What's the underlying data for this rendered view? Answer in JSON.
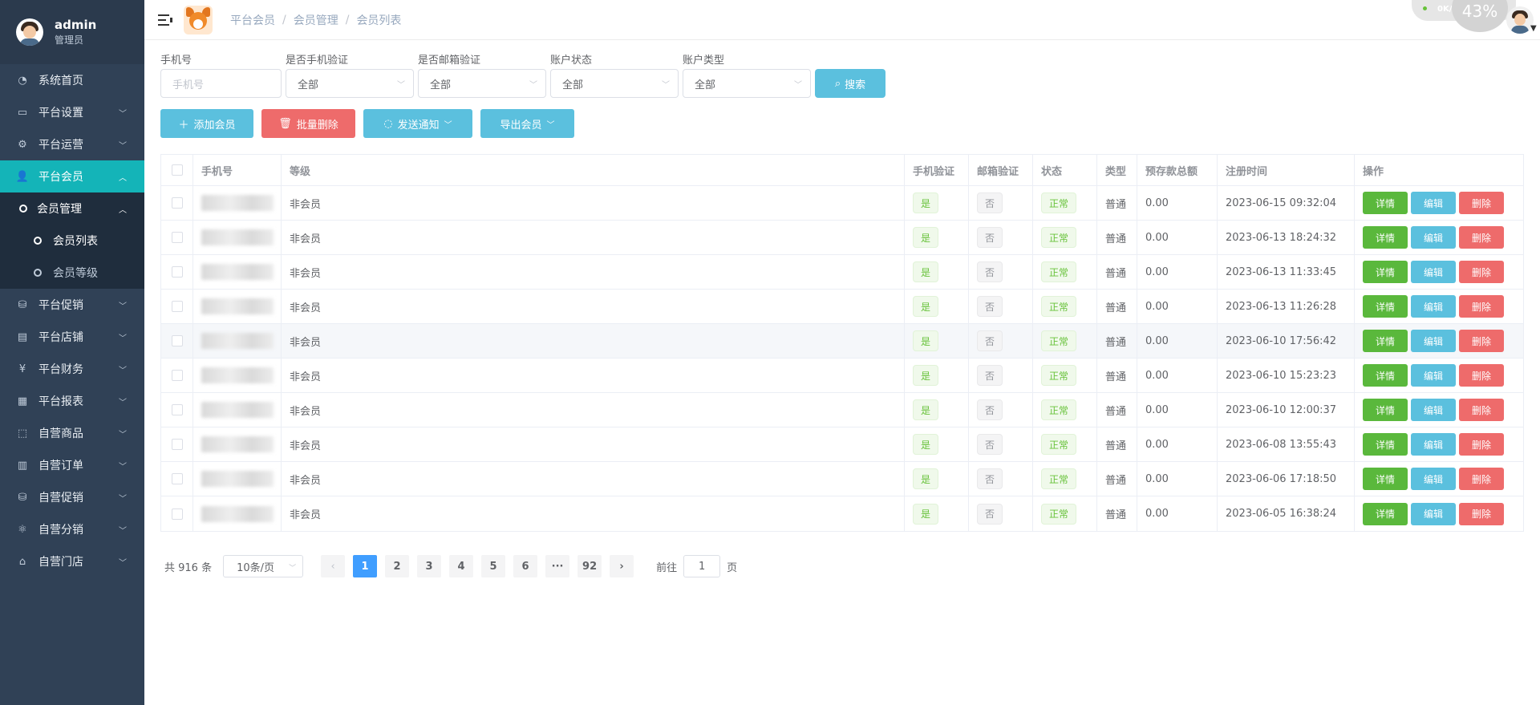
{
  "user": {
    "name": "admin",
    "role": "管理员"
  },
  "sidebar": {
    "items": [
      {
        "label": "系统首页",
        "icon": "dashboard-icon",
        "expandable": false
      },
      {
        "label": "平台设置",
        "icon": "monitor-icon",
        "expandable": true
      },
      {
        "label": "平台运营",
        "icon": "gear-icon",
        "expandable": true
      },
      {
        "label": "平台会员",
        "icon": "member-icon",
        "expandable": true,
        "active": true
      }
    ],
    "sub": {
      "label": "会员管理"
    },
    "subsub": [
      {
        "label": "会员列表",
        "current": true
      },
      {
        "label": "会员等级",
        "current": false
      }
    ],
    "items2": [
      {
        "label": "平台促销",
        "icon": "promo-icon"
      },
      {
        "label": "平台店铺",
        "icon": "shop-icon"
      },
      {
        "label": "平台财务",
        "icon": "yen-icon"
      },
      {
        "label": "平台报表",
        "icon": "report-icon"
      },
      {
        "label": "自营商品",
        "icon": "goods-icon"
      },
      {
        "label": "自营订单",
        "icon": "order-icon"
      },
      {
        "label": "自营促销",
        "icon": "promo-icon"
      },
      {
        "label": "自营分销",
        "icon": "distribution-icon"
      },
      {
        "label": "自营门店",
        "icon": "store-icon"
      }
    ]
  },
  "header": {
    "breadcrumb": [
      "平台会员",
      "会员管理",
      "会员列表"
    ],
    "net_speed": "0K/s",
    "gauge": "43%"
  },
  "filters": {
    "phone": {
      "label": "手机号",
      "placeholder": "手机号"
    },
    "phone_verified": {
      "label": "是否手机验证",
      "value": "全部"
    },
    "email_verified": {
      "label": "是否邮箱验证",
      "value": "全部"
    },
    "account_status": {
      "label": "账户状态",
      "value": "全部"
    },
    "account_type": {
      "label": "账户类型",
      "value": "全部"
    },
    "search_label": "搜索"
  },
  "actions": {
    "add": "添加会员",
    "batch_delete": "批量删除",
    "notify": "发送通知",
    "export": "导出会员"
  },
  "table": {
    "headers": {
      "phone": "手机号",
      "level": "等级",
      "phone_verify": "手机验证",
      "email_verify": "邮箱验证",
      "status": "状态",
      "type": "类型",
      "balance": "预存款总额",
      "reg_time": "注册时间",
      "ops": "操作"
    },
    "op_labels": {
      "detail": "详情",
      "edit": "编辑",
      "delete": "删除"
    },
    "rows": [
      {
        "level": "非会员",
        "phone_verify": "是",
        "email_verify": "否",
        "status": "正常",
        "type": "普通",
        "balance": "0.00",
        "reg_time": "2023-06-15 09:32:04"
      },
      {
        "level": "非会员",
        "phone_verify": "是",
        "email_verify": "否",
        "status": "正常",
        "type": "普通",
        "balance": "0.00",
        "reg_time": "2023-06-13 18:24:32"
      },
      {
        "level": "非会员",
        "phone_verify": "是",
        "email_verify": "否",
        "status": "正常",
        "type": "普通",
        "balance": "0.00",
        "reg_time": "2023-06-13 11:33:45"
      },
      {
        "level": "非会员",
        "phone_verify": "是",
        "email_verify": "否",
        "status": "正常",
        "type": "普通",
        "balance": "0.00",
        "reg_time": "2023-06-13 11:26:28"
      },
      {
        "level": "非会员",
        "phone_verify": "是",
        "email_verify": "否",
        "status": "正常",
        "type": "普通",
        "balance": "0.00",
        "reg_time": "2023-06-10 17:56:42"
      },
      {
        "level": "非会员",
        "phone_verify": "是",
        "email_verify": "否",
        "status": "正常",
        "type": "普通",
        "balance": "0.00",
        "reg_time": "2023-06-10 15:23:23"
      },
      {
        "level": "非会员",
        "phone_verify": "是",
        "email_verify": "否",
        "status": "正常",
        "type": "普通",
        "balance": "0.00",
        "reg_time": "2023-06-10 12:00:37"
      },
      {
        "level": "非会员",
        "phone_verify": "是",
        "email_verify": "否",
        "status": "正常",
        "type": "普通",
        "balance": "0.00",
        "reg_time": "2023-06-08 13:55:43"
      },
      {
        "level": "非会员",
        "phone_verify": "是",
        "email_verify": "否",
        "status": "正常",
        "type": "普通",
        "balance": "0.00",
        "reg_time": "2023-06-06 17:18:50"
      },
      {
        "level": "非会员",
        "phone_verify": "是",
        "email_verify": "否",
        "status": "正常",
        "type": "普通",
        "balance": "0.00",
        "reg_time": "2023-06-05 16:38:24"
      }
    ]
  },
  "pagination": {
    "total": "共 916 条",
    "page_size": "10条/页",
    "pages": [
      "1",
      "2",
      "3",
      "4",
      "5",
      "6",
      "···",
      "92"
    ],
    "current": "1",
    "goto_prefix": "前往",
    "goto_value": "1",
    "goto_suffix": "页"
  },
  "colors": {
    "sidebar_bg": "#304156",
    "active_menu": "#14b4b8",
    "search_btn": "#5bc0de",
    "add_btn": "#5bc0de",
    "delete_btn": "#ee6b6b",
    "detail_btn": "#5ab83c",
    "page_active": "#409eff"
  }
}
